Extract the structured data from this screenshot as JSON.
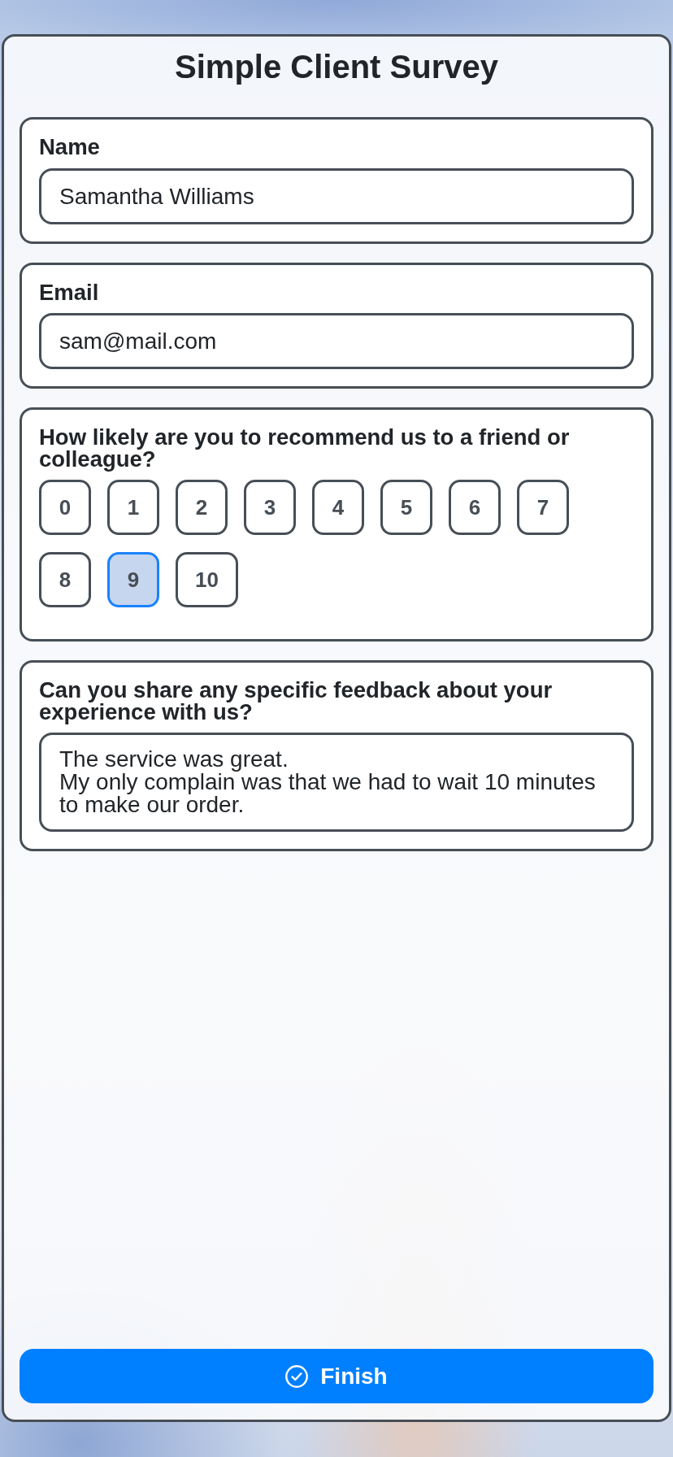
{
  "title": "Simple Client Survey",
  "questions": [
    {
      "kind": "input",
      "label": "Name",
      "value": "Samantha Williams"
    },
    {
      "kind": "input",
      "label": "Email",
      "value": "sam@mail.com"
    },
    {
      "kind": "scale",
      "label": "How likely are you to recommend us to a friend or colleague?",
      "options": [
        {
          "label": "0",
          "selected": false
        },
        {
          "label": "1",
          "selected": false
        },
        {
          "label": "2",
          "selected": false
        },
        {
          "label": "3",
          "selected": false
        },
        {
          "label": "4",
          "selected": false
        },
        {
          "label": "5",
          "selected": false
        },
        {
          "label": "6",
          "selected": false
        },
        {
          "label": "7",
          "selected": false
        },
        {
          "label": "8",
          "selected": false
        },
        {
          "label": "9",
          "selected": true
        },
        {
          "label": "10",
          "selected": false
        }
      ]
    },
    {
      "kind": "textarea",
      "label": "Can you share any specific feedback about your experience with us?",
      "value": "The service was great.\nMy only complain was that we had to wait 10 minutes to make our order."
    }
  ],
  "finish_button": {
    "label": "Finish"
  }
}
